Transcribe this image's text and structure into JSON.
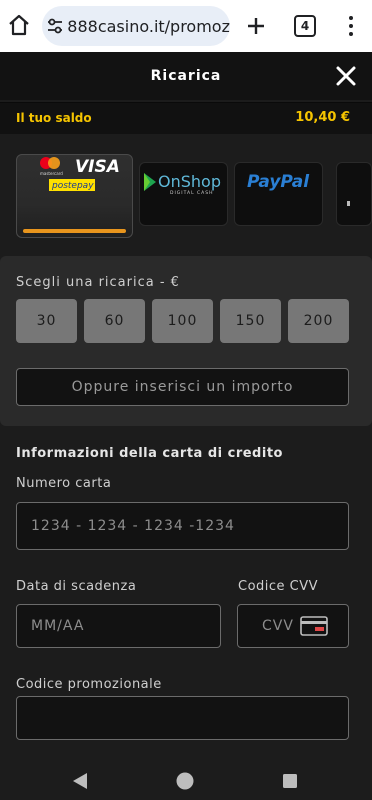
{
  "browser": {
    "url": "888casino.it/promoz",
    "tab_count": "4"
  },
  "header": {
    "title": "Ricarica"
  },
  "balance": {
    "label": "Il tuo saldo",
    "value": "10,40 €"
  },
  "payment_methods": [
    {
      "name": "cards",
      "logos": [
        "mastercard",
        "VISA",
        "postepay"
      ],
      "selected": true
    },
    {
      "name": "onshop",
      "logo_text": "OnShop",
      "sub_text": "DIGITAL CASH",
      "selected": false
    },
    {
      "name": "paypal",
      "logo_text": "PayPal",
      "selected": false
    }
  ],
  "amount": {
    "label": "Scegli una ricarica - €",
    "options": [
      "30",
      "60",
      "100",
      "150",
      "200"
    ],
    "custom_placeholder": "Oppure inserisci un importo"
  },
  "card_form": {
    "section_title": "Informazioni della carta di credito",
    "number_label": "Numero carta",
    "number_placeholder": "1234 - 1234 - 1234 -1234",
    "expiry_label": "Data di scadenza",
    "expiry_placeholder": "MM/AA",
    "cvv_label": "Codice CVV",
    "cvv_placeholder": "CVV",
    "promo_label": "Codice promozionale",
    "promo_value": ""
  },
  "colors": {
    "accent_yellow": "#f5c400",
    "progress_orange": "#e8951d",
    "background": "#1c1c1c"
  },
  "icons": [
    "home-icon",
    "site-settings-icon",
    "plus-icon",
    "tab-switcher-icon",
    "more-vert-icon",
    "close-icon",
    "credit-card-icon",
    "back-icon",
    "home-circle-icon",
    "recents-icon"
  ]
}
